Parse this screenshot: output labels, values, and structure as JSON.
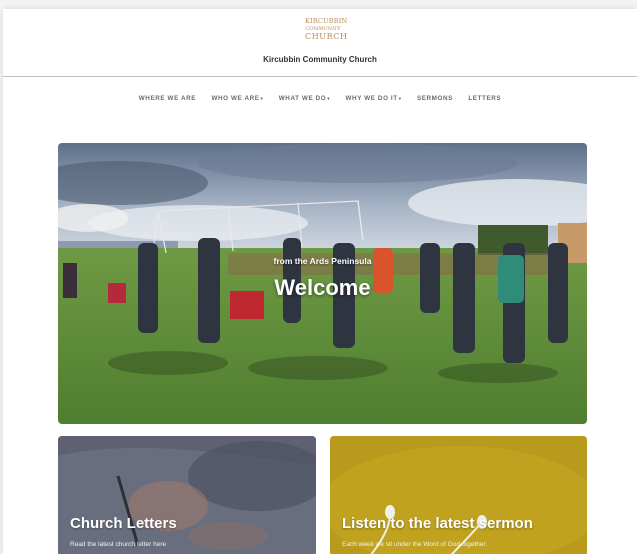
{
  "logo": {
    "line1": "KIRCUBBIN",
    "line2": "COMMUNITY",
    "line3": "CHURCH"
  },
  "site": {
    "title": "Kircubbin Community Church"
  },
  "nav": {
    "items": [
      {
        "label": "WHERE WE ARE",
        "dropdown": false
      },
      {
        "label": "WHO WE ARE",
        "dropdown": true
      },
      {
        "label": "WHAT WE DO",
        "dropdown": true
      },
      {
        "label": "WHY WE DO IT",
        "dropdown": true
      },
      {
        "label": "SERMONS",
        "dropdown": false
      },
      {
        "label": "LETTERS",
        "dropdown": false
      }
    ],
    "caret": "▾"
  },
  "hero": {
    "subtitle": "from the Ards Peninsula",
    "title": "Welcome"
  },
  "cards": {
    "letters": {
      "title": "Church Letters",
      "text": "Read the latest church letter here"
    },
    "sermon": {
      "title": "Listen to the latest sermon",
      "text": "Each week we sit under the Word of God together."
    }
  },
  "colors": {
    "logo": "#b98a52",
    "sermon_card": "#b99a1c",
    "letters_card": "#5b5f70",
    "nav_text": "#6b6b6b"
  }
}
